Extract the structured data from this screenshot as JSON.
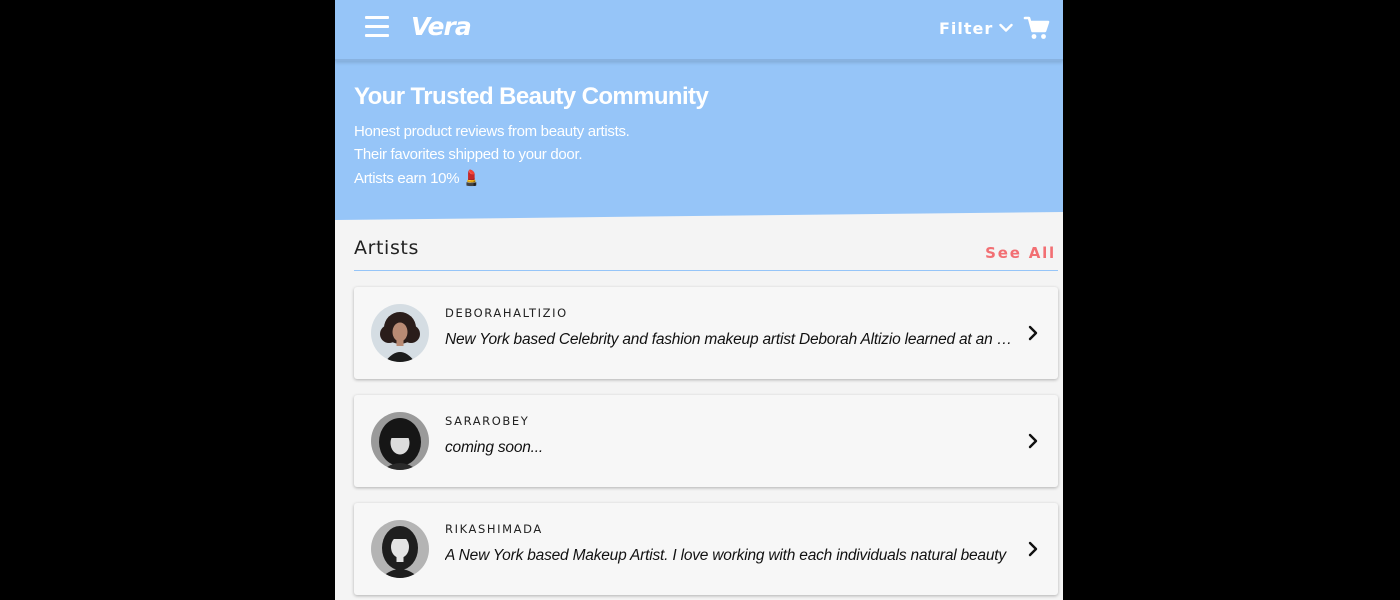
{
  "header": {
    "logo": "Vera",
    "filter_label": "Filter",
    "icons": {
      "menu": "hamburger-menu-icon",
      "filter": "chevron-down-icon",
      "cart": "shopping-cart-icon"
    }
  },
  "hero": {
    "title": "Your Trusted Beauty Community",
    "line1": "Honest product reviews from beauty artists.",
    "line2": "Their favorites shipped to your door.",
    "line3": "Artists earn 10%",
    "emoji": "💄"
  },
  "artists": {
    "title": "Artists",
    "see_all": "See All",
    "items": [
      {
        "username": "DEBORAHALTIZIO",
        "bio": "New York based Celebrity and fashion makeup artist Deborah Altizio learned at an early age"
      },
      {
        "username": "SARAROBEY",
        "bio": "coming soon..."
      },
      {
        "username": "RIKASHIMADA",
        "bio": "A New York based Makeup Artist. I love working with each individuals natural beauty"
      }
    ]
  },
  "colors": {
    "brand_blue": "#96c5f8",
    "accent_coral": "#f26f73",
    "page_background": "#f4f4f4"
  }
}
